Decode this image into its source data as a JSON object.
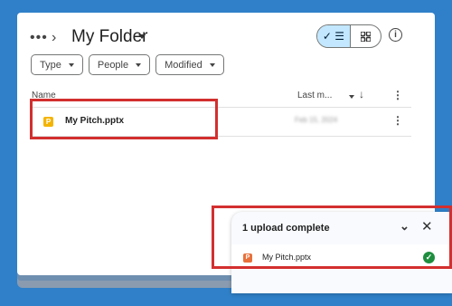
{
  "breadcrumb": {
    "more": "•••",
    "separator": "›",
    "folder_title": "My Folder"
  },
  "toolbar": {
    "list_view_icon": "check-list-icon",
    "grid_view_icon": "grid-icon",
    "info_icon": "info-icon",
    "list_glyph": "✓ ☰",
    "info_glyph": "i"
  },
  "filters": [
    {
      "label": "Type"
    },
    {
      "label": "People"
    },
    {
      "label": "Modified"
    }
  ],
  "table": {
    "headers": {
      "name": "Name",
      "last_modified": "Last m...",
      "sort_glyph": "↓",
      "more_glyph": "⋮"
    },
    "rows": [
      {
        "icon": "P",
        "name": "My Pitch.pptx",
        "date": "Feb 15, 2024",
        "more_glyph": "⋮"
      }
    ]
  },
  "upload": {
    "title": "1 upload complete",
    "collapse_glyph": "⌄",
    "close_glyph": "✕",
    "items": [
      {
        "icon": "P",
        "name": "My Pitch.pptx",
        "status_glyph": "✓"
      }
    ]
  },
  "colors": {
    "background": "#2f80c9",
    "highlight": "#d32f2f",
    "pptx_yellow": "#f4b400",
    "pptx_orange": "#e8713b",
    "success_green": "#1e8e3e",
    "toggle_active": "#c2e7ff"
  }
}
